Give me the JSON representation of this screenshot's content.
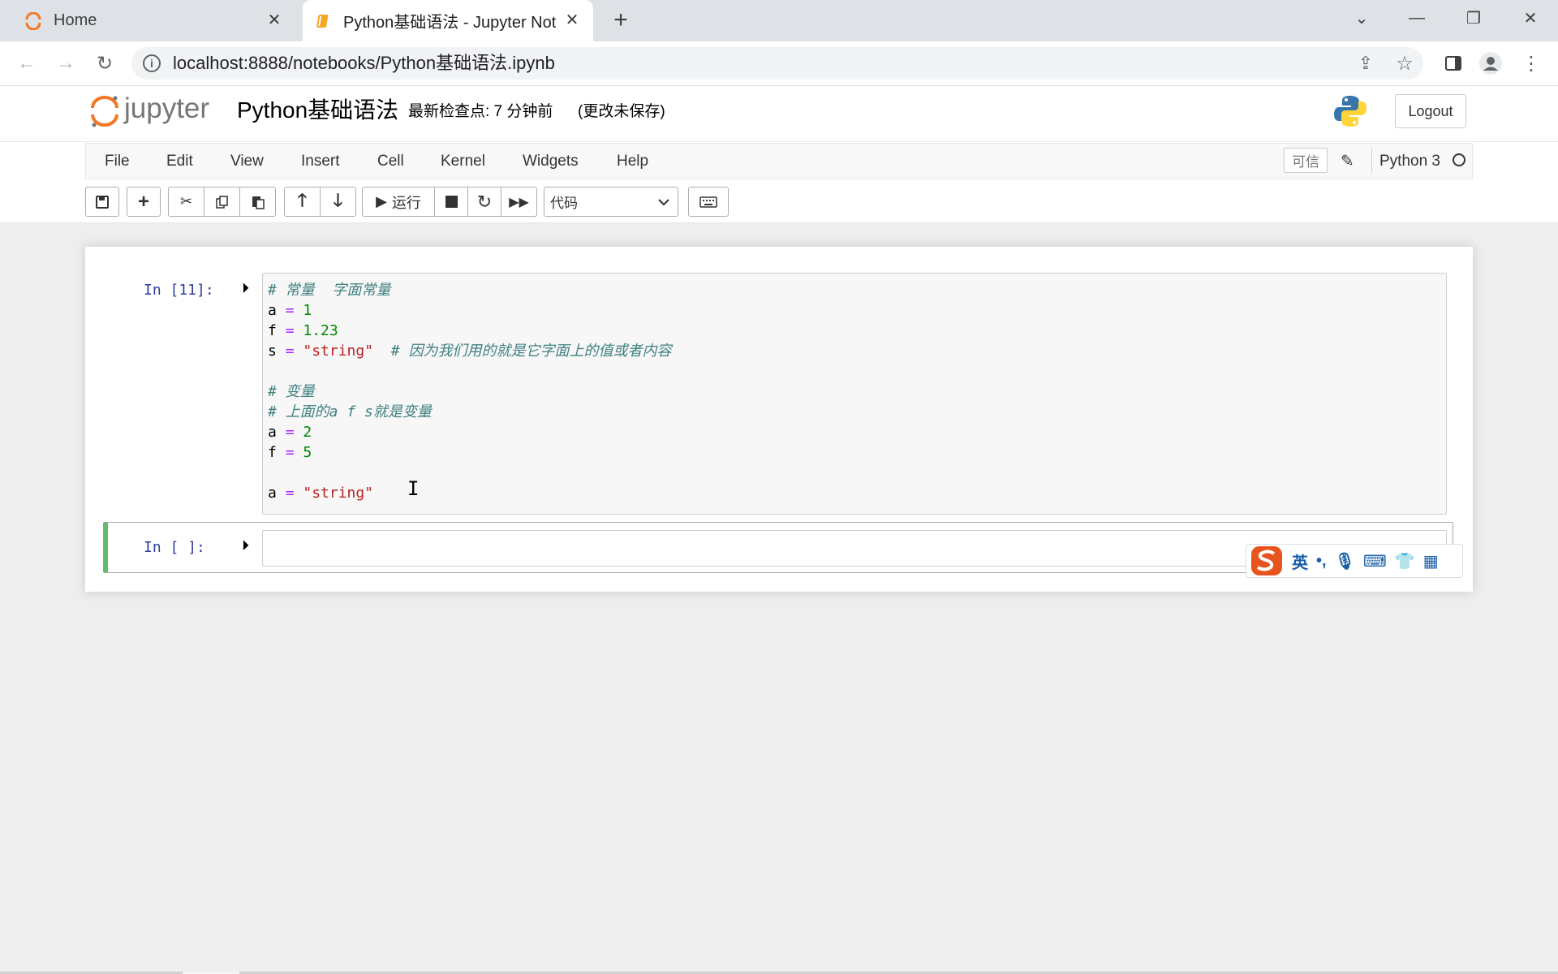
{
  "browser": {
    "tabs": [
      {
        "title": "Home",
        "close": "✕"
      },
      {
        "title": "Python基础语法 - Jupyter Note",
        "close": "✕"
      }
    ],
    "new_tab": "+",
    "url": "localhost:8888/notebooks/Python基础语法.ipynb"
  },
  "jupyter": {
    "logo_text": "jupyter",
    "notebook_title": "Python基础语法",
    "checkpoint": "最新检查点: 7 分钟前",
    "unsaved": "(更改未保存)",
    "logout": "Logout",
    "menu": [
      "File",
      "Edit",
      "View",
      "Insert",
      "Cell",
      "Kernel",
      "Widgets",
      "Help"
    ],
    "trusted": "可信",
    "kernel": "Python 3",
    "run_label": "运行",
    "cell_type": "代码"
  },
  "cells": [
    {
      "prompt": "In [11]:",
      "lines": [
        "# 常量  字面常量",
        "a = 1",
        "f = 1.23",
        "s = \"string\"  # 因为我们用的就是它字面上的值或者内容",
        "",
        "# 变量",
        "# 上面的a f s就是变量",
        "a = 2",
        "f = 5",
        "",
        "a = \"string\""
      ]
    },
    {
      "prompt": "In [ ]:"
    }
  ],
  "ime": {
    "label": "英"
  },
  "colors": {
    "comment": "#408080",
    "operator": "#AA22FF",
    "number": "#008800",
    "string": "#BA2121",
    "selected_cell": "#66BB6A",
    "prompt": "#303F9F"
  }
}
